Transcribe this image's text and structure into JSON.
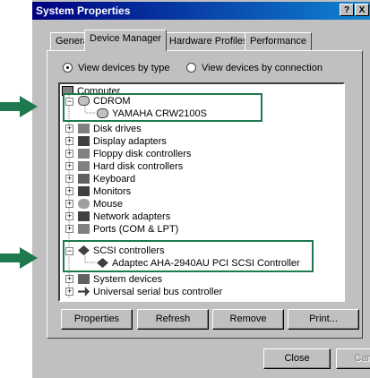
{
  "window": {
    "title": "System Properties",
    "help_label": "?",
    "close_label": "X"
  },
  "tabs": [
    {
      "label": "General"
    },
    {
      "label": "Device Manager"
    },
    {
      "label": "Hardware Profiles"
    },
    {
      "label": "Performance"
    }
  ],
  "view_options": [
    {
      "label": "View devices by type",
      "selected": true
    },
    {
      "label": "View devices by connection",
      "selected": false
    }
  ],
  "tree": {
    "root": "Computer",
    "items": [
      {
        "label": "CDROM",
        "expanded": true
      },
      {
        "label": "YAMAHA CRW2100S",
        "child": true
      },
      {
        "label": "Disk drives"
      },
      {
        "label": "Display adapters"
      },
      {
        "label": "Floppy disk controllers"
      },
      {
        "label": "Hard disk controllers"
      },
      {
        "label": "Keyboard"
      },
      {
        "label": "Monitors"
      },
      {
        "label": "Mouse"
      },
      {
        "label": "Network adapters"
      },
      {
        "label": "Ports (COM & LPT)"
      },
      {
        "label": "SCSI controllers",
        "expanded": true
      },
      {
        "label": "Adaptec AHA-2940AU PCI SCSI Controller",
        "child": true
      },
      {
        "label": "System devices"
      },
      {
        "label": "Universal serial bus controller"
      }
    ]
  },
  "actions": [
    {
      "label": "Properties"
    },
    {
      "label": "Refresh"
    },
    {
      "label": "Remove"
    },
    {
      "label": "Print..."
    }
  ],
  "footer": {
    "close_label": "Close",
    "cancel_label": "Cancel"
  },
  "colors": {
    "highlight": "#1e7a4e",
    "title_start": "#000080",
    "title_end": "#1084d0"
  }
}
